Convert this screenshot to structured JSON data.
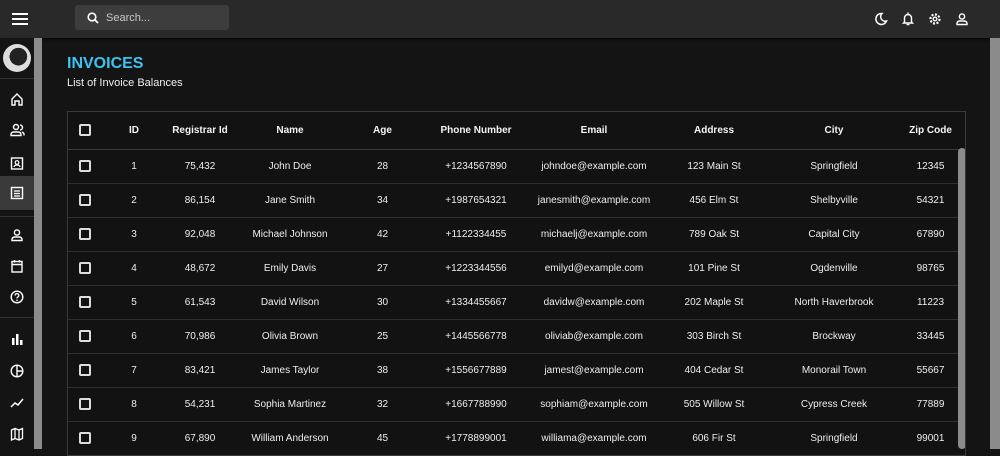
{
  "search": {
    "placeholder": "Search..."
  },
  "page": {
    "title": "INVOICES",
    "subtitle": "List of Invoice Balances"
  },
  "table": {
    "headers": [
      "ID",
      "Registrar Id",
      "Name",
      "Age",
      "Phone Number",
      "Email",
      "Address",
      "City",
      "Zip Code"
    ],
    "rows": [
      [
        "1",
        "75,432",
        "John Doe",
        "28",
        "+1234567890",
        "johndoe@example.com",
        "123 Main St",
        "Springfield",
        "12345"
      ],
      [
        "2",
        "86,154",
        "Jane Smith",
        "34",
        "+1987654321",
        "janesmith@example.com",
        "456 Elm St",
        "Shelbyville",
        "54321"
      ],
      [
        "3",
        "92,048",
        "Michael Johnson",
        "42",
        "+1122334455",
        "michaelj@example.com",
        "789 Oak St",
        "Capital City",
        "67890"
      ],
      [
        "4",
        "48,672",
        "Emily Davis",
        "27",
        "+1223344556",
        "emilyd@example.com",
        "101 Pine St",
        "Ogdenville",
        "98765"
      ],
      [
        "5",
        "61,543",
        "David Wilson",
        "30",
        "+1334455667",
        "davidw@example.com",
        "202 Maple St",
        "North Haverbrook",
        "11223"
      ],
      [
        "6",
        "70,986",
        "Olivia Brown",
        "25",
        "+1445566778",
        "oliviab@example.com",
        "303 Birch St",
        "Brockway",
        "33445"
      ],
      [
        "7",
        "83,421",
        "James Taylor",
        "38",
        "+1556677889",
        "jamest@example.com",
        "404 Cedar St",
        "Monorail Town",
        "55667"
      ],
      [
        "8",
        "54,231",
        "Sophia Martinez",
        "32",
        "+1667788990",
        "sophiam@example.com",
        "505 Willow St",
        "Cypress Creek",
        "77889"
      ],
      [
        "9",
        "67,890",
        "William Anderson",
        "45",
        "+1778899001",
        "williama@example.com",
        "606 Fir St",
        "Springfield",
        "99001"
      ]
    ]
  },
  "colors": {
    "accent": "#3cc3f2"
  }
}
